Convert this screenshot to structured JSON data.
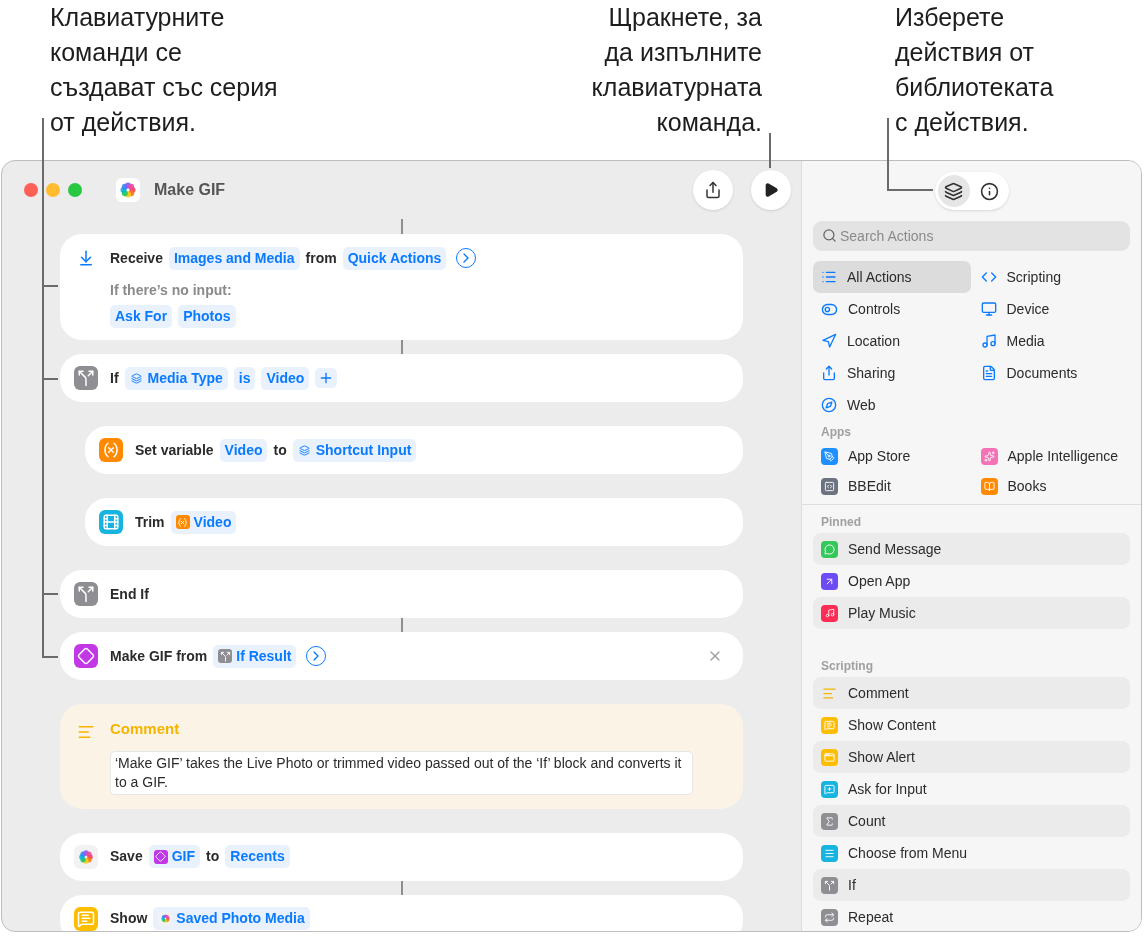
{
  "callouts": [
    {
      "lines": [
        "Клавиатурните",
        "команди се",
        "създават със серия",
        "от действия."
      ]
    },
    {
      "lines": [
        "Щракнете, за",
        "да изпълните",
        "клавиатурната",
        "команда."
      ]
    },
    {
      "lines": [
        "Изберете",
        "действия от",
        "библиотеката",
        "с действия."
      ]
    }
  ],
  "window": {
    "title": "Make GIF"
  },
  "actions": [
    {
      "kind": "receive",
      "hovered": false,
      "parts": [
        {
          "kind": "label",
          "text": "Receive"
        },
        {
          "kind": "token",
          "text": "Images and Media"
        },
        {
          "kind": "label",
          "text": "from"
        },
        {
          "kind": "token",
          "text": "Quick Actions"
        },
        {
          "kind": "more"
        }
      ],
      "note": "If there’s no input:",
      "note_tokens": [
        "Ask For",
        "Photos"
      ]
    },
    {
      "kind": "if",
      "hovered": false,
      "parts": [
        {
          "kind": "label",
          "text": "If"
        },
        {
          "kind": "input",
          "text": "Media Type"
        },
        {
          "kind": "token",
          "text": "is"
        },
        {
          "kind": "token",
          "text": "Video"
        },
        {
          "kind": "plus"
        }
      ],
      "children": [
        {
          "kind": "variable",
          "hovered": false,
          "parts": [
            {
              "kind": "label",
              "text": "Set variable"
            },
            {
              "kind": "token",
              "text": "Video"
            },
            {
              "kind": "label",
              "text": "to"
            },
            {
              "kind": "input",
              "text": "Shortcut Input"
            }
          ]
        },
        {
          "kind": "trim",
          "hovered": false,
          "parts": [
            {
              "kind": "label",
              "text": "Trim"
            },
            {
              "kind": "variable",
              "text": "Video"
            }
          ]
        }
      ]
    },
    {
      "kind": "if",
      "hovered": false,
      "parts": [
        {
          "kind": "label",
          "text": "End If"
        }
      ]
    },
    {
      "kind": "gif",
      "hovered": true,
      "parts": [
        {
          "kind": "label",
          "text": "Make GIF from"
        },
        {
          "kind": "if",
          "text": "If Result"
        },
        {
          "kind": "more"
        }
      ]
    },
    {
      "kind": "comment",
      "hovered": false,
      "title": "Comment",
      "text": "‘Make GIF’ takes the Live Photo or trimmed video passed out of the ‘If’ block and converts it to a GIF."
    },
    {
      "kind": "photos",
      "hovered": false,
      "parts": [
        {
          "kind": "label",
          "text": "Save"
        },
        {
          "kind": "gif",
          "text": "GIF"
        },
        {
          "kind": "label",
          "text": "to"
        },
        {
          "kind": "token",
          "text": "Recents"
        }
      ]
    },
    {
      "kind": "show",
      "hovered": false,
      "parts": [
        {
          "kind": "label",
          "text": "Show"
        },
        {
          "kind": "photos",
          "text": "Saved Photo Media"
        }
      ]
    }
  ],
  "sidebar": {
    "tabs": [
      {
        "kind": "library",
        "selected": true
      },
      {
        "kind": "info",
        "selected": false
      }
    ],
    "search": {
      "placeholder": "Search Actions"
    },
    "categories": [
      {
        "label": "All Actions",
        "kind": "list",
        "selected": true
      },
      {
        "label": "Scripting",
        "kind": "scripting",
        "selected": false
      },
      {
        "label": "Controls",
        "kind": "controls",
        "selected": false
      },
      {
        "label": "Device",
        "kind": "device",
        "selected": false
      },
      {
        "label": "Location",
        "kind": "location",
        "selected": false
      },
      {
        "label": "Media",
        "kind": "music",
        "selected": false
      },
      {
        "label": "Sharing",
        "kind": "share",
        "selected": false
      },
      {
        "label": "Documents",
        "kind": "document",
        "selected": false
      },
      {
        "label": "Web",
        "kind": "compass",
        "selected": false
      }
    ],
    "apps": {
      "title": "Apps",
      "items": [
        {
          "label": "App Store",
          "kind": "appstore"
        },
        {
          "label": "Apple Intelligence",
          "kind": "intelligence"
        },
        {
          "label": "BBEdit",
          "kind": "bbedit"
        },
        {
          "label": "Books",
          "kind": "books"
        }
      ]
    },
    "sections": [
      {
        "title": "Pinned",
        "items": [
          {
            "label": "Send Message",
            "kind": "message"
          },
          {
            "label": "Open App",
            "kind": "openapp"
          },
          {
            "label": "Play Music",
            "kind": "playmusic"
          }
        ]
      },
      {
        "title": "Scripting",
        "items": [
          {
            "label": "Comment",
            "kind": "comment"
          },
          {
            "label": "Show Content",
            "kind": "show"
          },
          {
            "label": "Show Alert",
            "kind": "alert"
          },
          {
            "label": "Ask for Input",
            "kind": "ask"
          },
          {
            "label": "Count",
            "kind": "count"
          },
          {
            "label": "Choose from Menu",
            "kind": "menu"
          },
          {
            "label": "If",
            "kind": "if"
          },
          {
            "label": "Repeat",
            "kind": "repeat"
          }
        ]
      }
    ]
  }
}
